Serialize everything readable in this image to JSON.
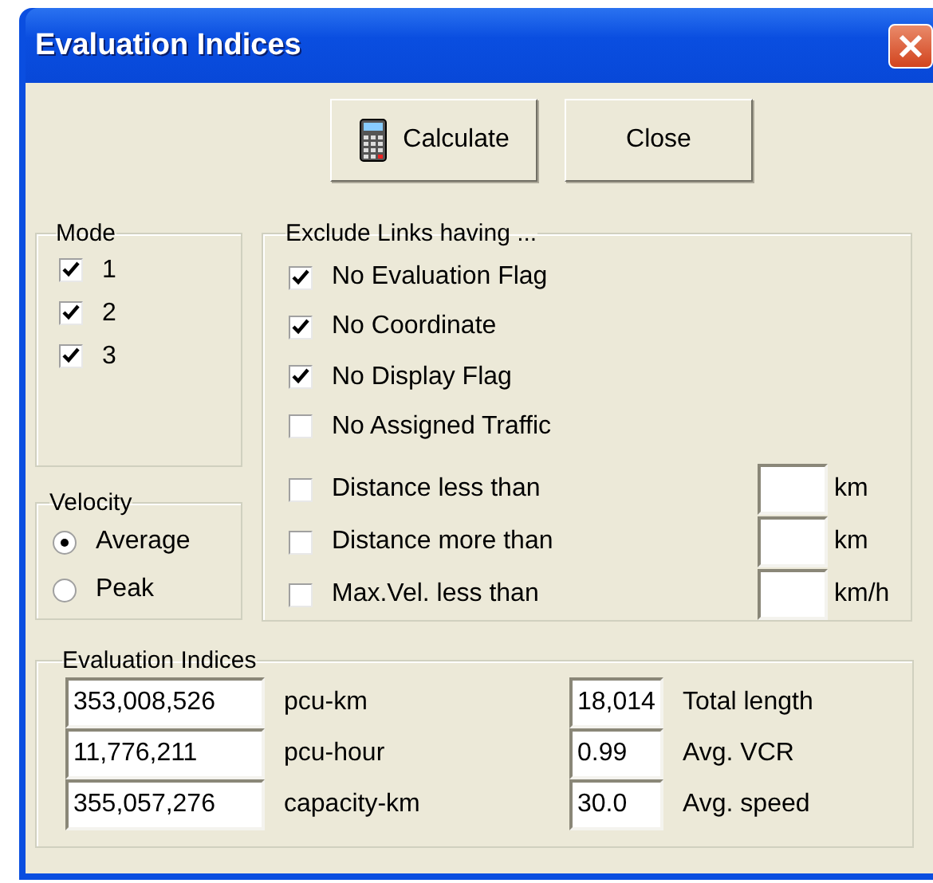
{
  "window": {
    "title": "Evaluation Indices"
  },
  "buttons": [
    {
      "label": "Calculate",
      "kind": "icon"
    },
    {
      "label": "Close",
      "kind": "plain"
    }
  ],
  "mode": {
    "title": "Mode",
    "items": [
      {
        "label": "1",
        "checked": true
      },
      {
        "label": "2",
        "checked": true
      },
      {
        "label": "3",
        "checked": true
      }
    ]
  },
  "velocity": {
    "title": "Velocity",
    "options": [
      {
        "label": "Average",
        "selected": true
      },
      {
        "label": "Peak",
        "selected": false
      }
    ]
  },
  "exclude": {
    "title": "Exclude Links having ...",
    "items": [
      {
        "label": "No Evaluation Flag",
        "checked": true,
        "kind": "flag"
      },
      {
        "label": "No Coordinate",
        "checked": true,
        "kind": "flag"
      },
      {
        "label": "No Display Flag",
        "checked": true,
        "kind": "flag"
      },
      {
        "label": "No Assigned Traffic",
        "checked": false,
        "kind": "flag"
      },
      {
        "label": "Distance less than",
        "checked": false,
        "kind": "threshold",
        "unit": "km"
      },
      {
        "label": "Distance more than",
        "checked": false,
        "kind": "threshold",
        "unit": "km"
      },
      {
        "label": "Max.Vel. less than",
        "checked": false,
        "kind": "threshold",
        "unit": "km/h"
      }
    ]
  },
  "indices": {
    "title": "Evaluation Indices",
    "left": [
      {
        "value": "353,008,526",
        "label": "pcu-km"
      },
      {
        "value": "11,776,211",
        "label": "pcu-hour"
      },
      {
        "value": "355,057,276",
        "label": "capacity-km"
      }
    ],
    "right": [
      {
        "value": "18,014",
        "label": "Total length"
      },
      {
        "value": "0.99",
        "label": "Avg. VCR"
      },
      {
        "value": "30.0",
        "label": "Avg. speed"
      }
    ]
  }
}
